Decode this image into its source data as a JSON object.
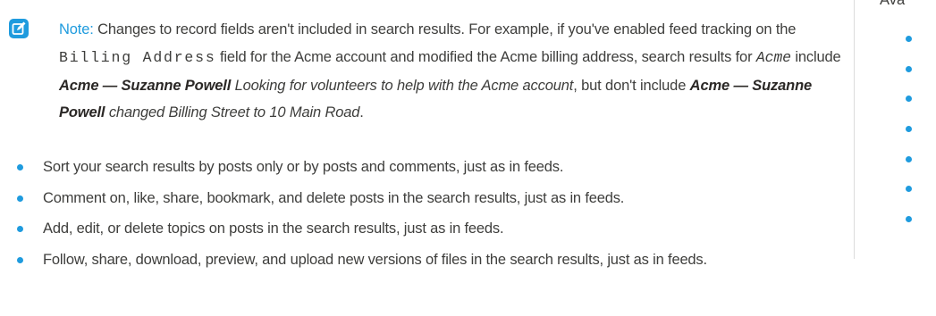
{
  "note": {
    "icon": "edit-note-icon",
    "label": "Note:",
    "t1": " Changes to record fields aren't included in search results. For example, if you've enabled feed tracking on the ",
    "field_code": "Billing Address",
    "t2": " field for the Acme account and modified the Acme billing address, search results for ",
    "search_code": "Acme",
    "t3": " include ",
    "bold1": "Acme — Suzanne Powell",
    "ital1": " Looking for volunteers to help with the Acme account",
    "t4": ", but don't include ",
    "bold2": "Acme — Suzanne Powell",
    "ital2": "changed Billing Street to 10 Main Road",
    "t5": "."
  },
  "bullets": [
    "Sort your search results by posts only or by posts and comments, just as in feeds.",
    "Comment on, like, share, bookmark, and delete posts in the search results, just as in feeds.",
    "Add, edit, or delete topics on posts in the search results, just as in feeds.",
    "Follow, share, download, preview, and upload new versions of files in the search results, just as in feeds."
  ],
  "sidebar": {
    "title": "Ava",
    "bullet_count": 7
  },
  "colors": {
    "accent": "#1f9bde",
    "text": "#3e3e3c"
  }
}
